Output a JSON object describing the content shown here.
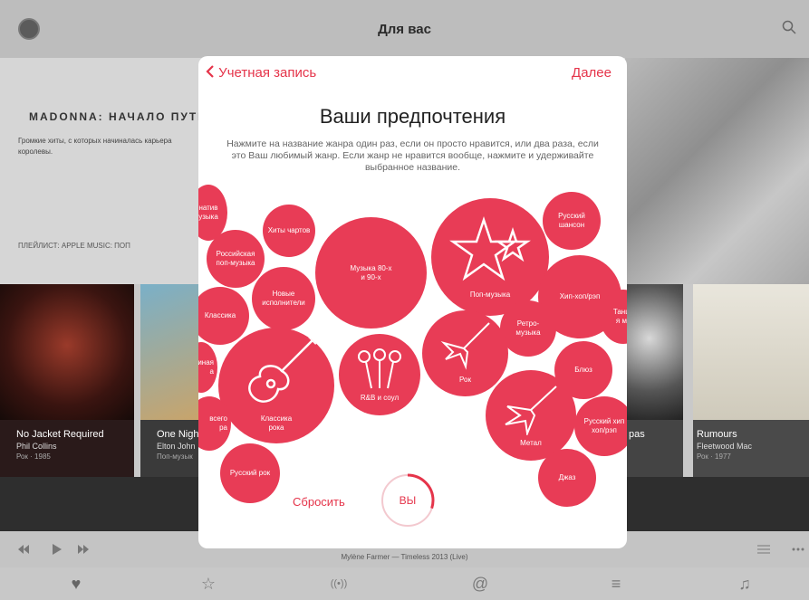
{
  "background": {
    "nav_title": "Для вас",
    "hero_title": "MADONNA: НАЧАЛО ПУТИ",
    "hero_subtitle": "Громкие хиты, с которых начиналась карьера королевы.",
    "hero_playlist": "ПЛЕЙЛИСТ: APPLE MUSIC: ПОП",
    "tiles": [
      {
        "title": "No Jacket Required",
        "artist": "Phil Collins",
        "meta": "Рок · 1985"
      },
      {
        "title": "One Nigh",
        "artist": "Elton John",
        "meta": "Поп-музык"
      },
      {
        "title": "pas",
        "artist": "",
        "meta": ""
      },
      {
        "title": "Rumours",
        "artist": "Fleetwood Mac",
        "meta": "Рок · 1977"
      }
    ],
    "now_playing": "Mylène Farmer — Timeless 2013 (Live)"
  },
  "modal": {
    "back_label": "Учетная запись",
    "next_label": "Далее",
    "title": "Ваши предпочтения",
    "instructions": "Нажмите на название жанра один раз, если он просто нравится, или два раза, если это Ваш любимый жанр. Если жанр не нравится вообще, нажмите и удерживайте выбранное название.",
    "reset_label": "Сбросить",
    "you_label": "ВЫ",
    "progress": 0.3
  },
  "bubbles": {
    "alt": "натив\nузыка",
    "hits": "Хиты чартов",
    "ru_pop": "Российская\nпоп-музыка",
    "music80": "Музыка 80-х\nи 90-х",
    "pop": "Поп-музыка",
    "chanson": "Русский\nшансон",
    "new": "Новые\nисполнители",
    "classic": "Классика",
    "hiphop": "Хип-хоп/рэп",
    "dance": "Танце\nя му",
    "retro": "Ретро-\nмузыка",
    "edge1": "иная\nа",
    "blues": "Блюз",
    "rnb": "R&B и соул",
    "rock": "Рок",
    "classic_rock": "Классика\nрока",
    "metal": "Метал",
    "ru_hiphop": "Русский хип\nхоп/рэп",
    "edge2": "всего\nра",
    "ru_rock": "Русский рок",
    "jazz": "Джаз"
  },
  "colors": {
    "accent": "#e5344a",
    "bubble": "#e83c56"
  }
}
